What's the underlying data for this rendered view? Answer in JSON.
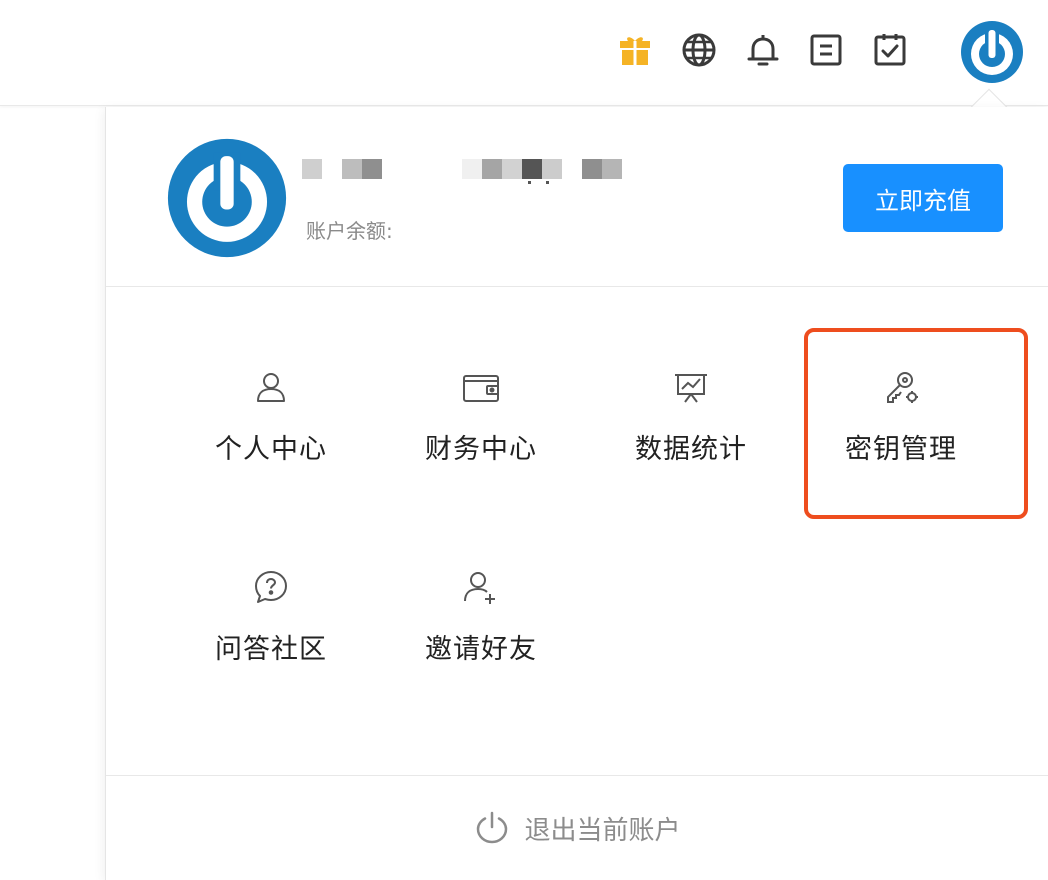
{
  "topbar": {
    "icons": [
      {
        "name": "gift-icon",
        "color": "#f5b325"
      },
      {
        "name": "globe-icon",
        "color": "#3a3a3a"
      },
      {
        "name": "bell-icon",
        "color": "#3a3a3a"
      },
      {
        "name": "document-icon",
        "color": "#3a3a3a"
      },
      {
        "name": "task-check-icon",
        "color": "#3a3a3a"
      }
    ],
    "avatar_icon": "power-avatar-icon"
  },
  "user": {
    "balance_label": "账户余额:",
    "recharge_label": "立即充值"
  },
  "menu": {
    "items": [
      {
        "label": "个人中心",
        "icon": "user-icon"
      },
      {
        "label": "财务中心",
        "icon": "wallet-icon"
      },
      {
        "label": "数据统计",
        "icon": "chart-board-icon"
      },
      {
        "label": "密钥管理",
        "icon": "key-settings-icon"
      },
      {
        "label": "问答社区",
        "icon": "question-bubble-icon"
      },
      {
        "label": "邀请好友",
        "icon": "add-user-icon"
      }
    ]
  },
  "logout": {
    "label": "退出当前账户"
  },
  "colors": {
    "accent": "#1890ff",
    "highlight": "#ee4d1e",
    "avatar_blue": "#1a7fc1"
  }
}
